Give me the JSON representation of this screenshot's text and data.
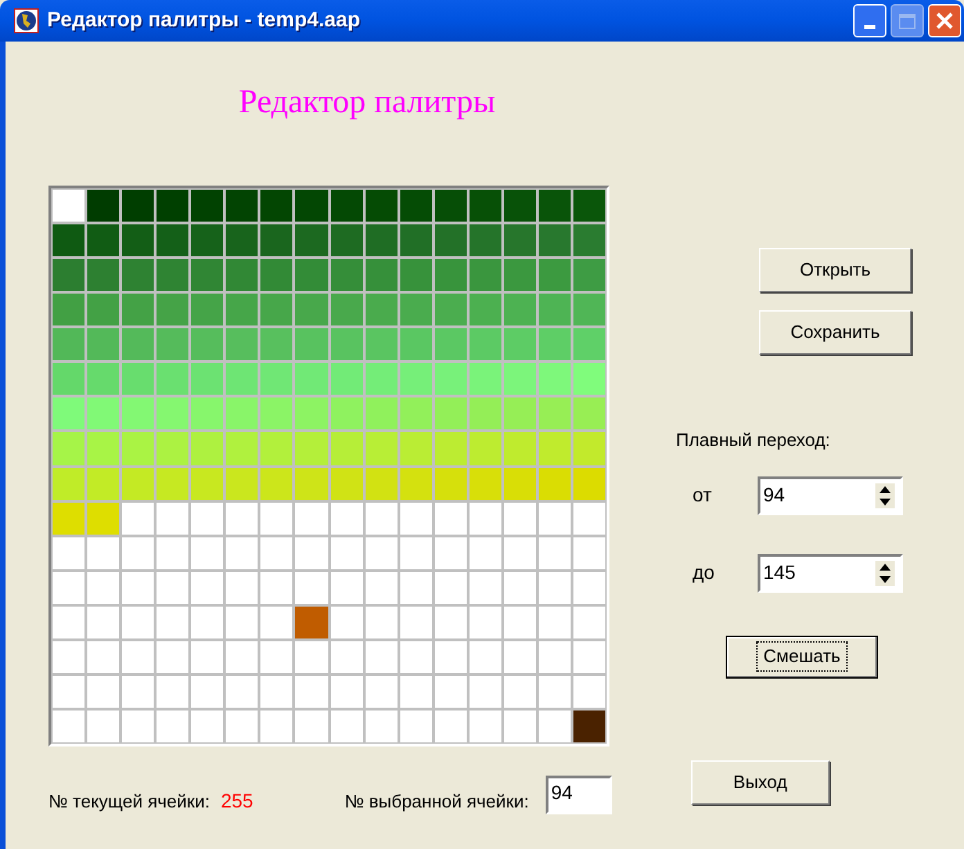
{
  "window": {
    "title": "Редактор палитры - temp4.aap",
    "maximize_disabled": true
  },
  "heading": "Редактор палитры",
  "palette": {
    "cells": [
      {
        "color": "#ffffff"
      },
      {
        "color": "#003c00"
      },
      {
        "color": "#003e00"
      },
      {
        "color": "#004000"
      },
      {
        "color": "#014201"
      },
      {
        "color": "#024402"
      },
      {
        "color": "#034602"
      },
      {
        "color": "#034703"
      },
      {
        "color": "#044904"
      },
      {
        "color": "#054b04"
      },
      {
        "color": "#054c05"
      },
      {
        "color": "#064e06"
      },
      {
        "color": "#075006"
      },
      {
        "color": "#085208"
      },
      {
        "color": "#095409"
      },
      {
        "color": "#0a560a"
      },
      {
        "color": "#0f5a12"
      },
      {
        "color": "#115c14"
      },
      {
        "color": "#135e16"
      },
      {
        "color": "#146018"
      },
      {
        "color": "#16621a"
      },
      {
        "color": "#18641c"
      },
      {
        "color": "#1a661e"
      },
      {
        "color": "#1c6920"
      },
      {
        "color": "#1e6b22"
      },
      {
        "color": "#1f6d24"
      },
      {
        "color": "#216f26"
      },
      {
        "color": "#237128"
      },
      {
        "color": "#25742a"
      },
      {
        "color": "#27762c"
      },
      {
        "color": "#28782e"
      },
      {
        "color": "#2a7c30"
      },
      {
        "color": "#2c7e30"
      },
      {
        "color": "#2d8031"
      },
      {
        "color": "#2e8232"
      },
      {
        "color": "#2f8433"
      },
      {
        "color": "#308634"
      },
      {
        "color": "#318835"
      },
      {
        "color": "#328a36"
      },
      {
        "color": "#338c37"
      },
      {
        "color": "#358e39"
      },
      {
        "color": "#36903a"
      },
      {
        "color": "#37923b"
      },
      {
        "color": "#38943c"
      },
      {
        "color": "#3a963e"
      },
      {
        "color": "#3b983f"
      },
      {
        "color": "#3c9a40"
      },
      {
        "color": "#3e9c44"
      },
      {
        "color": "#42a044"
      },
      {
        "color": "#43a145"
      },
      {
        "color": "#44a246"
      },
      {
        "color": "#45a347"
      },
      {
        "color": "#45a448"
      },
      {
        "color": "#46a649"
      },
      {
        "color": "#47a74a"
      },
      {
        "color": "#48a84b"
      },
      {
        "color": "#49a94c"
      },
      {
        "color": "#4aab4d"
      },
      {
        "color": "#4aac4e"
      },
      {
        "color": "#4bad4f"
      },
      {
        "color": "#4cb050"
      },
      {
        "color": "#4db252"
      },
      {
        "color": "#4eb454"
      },
      {
        "color": "#50b656"
      },
      {
        "color": "#52b858"
      },
      {
        "color": "#53b959"
      },
      {
        "color": "#54ba5a"
      },
      {
        "color": "#55bb5b"
      },
      {
        "color": "#56bd5c"
      },
      {
        "color": "#57be5d"
      },
      {
        "color": "#58c05e"
      },
      {
        "color": "#58c25f"
      },
      {
        "color": "#59c360"
      },
      {
        "color": "#5ac561"
      },
      {
        "color": "#5ac762"
      },
      {
        "color": "#5bc863"
      },
      {
        "color": "#5cca64"
      },
      {
        "color": "#5dcc65"
      },
      {
        "color": "#5ece66"
      },
      {
        "color": "#5fd068"
      },
      {
        "color": "#64d86a"
      },
      {
        "color": "#66da6c"
      },
      {
        "color": "#68dd6e"
      },
      {
        "color": "#6ae070"
      },
      {
        "color": "#6ce272"
      },
      {
        "color": "#6ee574"
      },
      {
        "color": "#70e775"
      },
      {
        "color": "#71e976"
      },
      {
        "color": "#72eb77"
      },
      {
        "color": "#74ed78"
      },
      {
        "color": "#76ef79"
      },
      {
        "color": "#78f17a"
      },
      {
        "color": "#7af37a"
      },
      {
        "color": "#7cf57b"
      },
      {
        "color": "#7ef87b"
      },
      {
        "color": "#80fc7c"
      },
      {
        "color": "#7ffa7a"
      },
      {
        "color": "#81f976"
      },
      {
        "color": "#83f873"
      },
      {
        "color": "#85f770"
      },
      {
        "color": "#87f66c"
      },
      {
        "color": "#89f569"
      },
      {
        "color": "#8bf466"
      },
      {
        "color": "#8df363"
      },
      {
        "color": "#8ff25f"
      },
      {
        "color": "#90f15c"
      },
      {
        "color": "#92f05a"
      },
      {
        "color": "#93ef58"
      },
      {
        "color": "#94ee57"
      },
      {
        "color": "#96ee56"
      },
      {
        "color": "#97ee55"
      },
      {
        "color": "#98ee54"
      },
      {
        "color": "#a6f448"
      },
      {
        "color": "#a8f446"
      },
      {
        "color": "#aaf344"
      },
      {
        "color": "#acf242"
      },
      {
        "color": "#aef140"
      },
      {
        "color": "#b0f13e"
      },
      {
        "color": "#b2f03c"
      },
      {
        "color": "#b4ef3a"
      },
      {
        "color": "#b6ee38"
      },
      {
        "color": "#b8ee36"
      },
      {
        "color": "#baed34"
      },
      {
        "color": "#bcec32"
      },
      {
        "color": "#bdec30"
      },
      {
        "color": "#bfeb2e"
      },
      {
        "color": "#c0eb2d"
      },
      {
        "color": "#c2ea2c"
      },
      {
        "color": "#c0ec28"
      },
      {
        "color": "#c2eb26"
      },
      {
        "color": "#c4ea24"
      },
      {
        "color": "#c6e922"
      },
      {
        "color": "#c8e820"
      },
      {
        "color": "#cae71e"
      },
      {
        "color": "#cce61b"
      },
      {
        "color": "#cee418"
      },
      {
        "color": "#d0e315"
      },
      {
        "color": "#d2e212"
      },
      {
        "color": "#d4e10f"
      },
      {
        "color": "#d6e00c"
      },
      {
        "color": "#d8df09"
      },
      {
        "color": "#d9de06"
      },
      {
        "color": "#dadd03"
      },
      {
        "color": "#dcdc00"
      },
      {
        "color": "#dede00"
      },
      {
        "color": "#dede00"
      },
      {
        "color": "#ffffff"
      },
      {
        "color": "#ffffff"
      },
      {
        "color": "#ffffff"
      },
      {
        "color": "#ffffff"
      },
      {
        "color": "#ffffff"
      },
      {
        "color": "#ffffff"
      },
      {
        "color": "#ffffff"
      },
      {
        "color": "#ffffff"
      },
      {
        "color": "#ffffff"
      },
      {
        "color": "#ffffff"
      },
      {
        "color": "#ffffff"
      },
      {
        "color": "#ffffff"
      },
      {
        "color": "#ffffff"
      },
      {
        "color": "#ffffff"
      },
      {
        "color": "#ffffff"
      },
      {
        "color": "#ffffff"
      },
      {
        "color": "#ffffff"
      },
      {
        "color": "#ffffff"
      },
      {
        "color": "#ffffff"
      },
      {
        "color": "#ffffff"
      },
      {
        "color": "#ffffff"
      },
      {
        "color": "#ffffff"
      },
      {
        "color": "#ffffff"
      },
      {
        "color": "#ffffff"
      },
      {
        "color": "#ffffff"
      },
      {
        "color": "#ffffff"
      },
      {
        "color": "#ffffff"
      },
      {
        "color": "#ffffff"
      },
      {
        "color": "#ffffff"
      },
      {
        "color": "#ffffff"
      },
      {
        "color": "#ffffff"
      },
      {
        "color": "#ffffff"
      },
      {
        "color": "#ffffff"
      },
      {
        "color": "#ffffff"
      },
      {
        "color": "#ffffff"
      },
      {
        "color": "#ffffff"
      },
      {
        "color": "#ffffff"
      },
      {
        "color": "#ffffff"
      },
      {
        "color": "#ffffff"
      },
      {
        "color": "#ffffff"
      },
      {
        "color": "#ffffff"
      },
      {
        "color": "#ffffff"
      },
      {
        "color": "#ffffff"
      },
      {
        "color": "#ffffff"
      },
      {
        "color": "#ffffff"
      },
      {
        "color": "#ffffff"
      },
      {
        "color": "#ffffff"
      },
      {
        "color": "#ffffff"
      },
      {
        "color": "#ffffff"
      },
      {
        "color": "#ffffff"
      },
      {
        "color": "#ffffff"
      },
      {
        "color": "#ffffff"
      },
      {
        "color": "#ffffff"
      },
      {
        "color": "#c05c00"
      },
      {
        "color": "#ffffff"
      },
      {
        "color": "#ffffff"
      },
      {
        "color": "#ffffff"
      },
      {
        "color": "#ffffff"
      },
      {
        "color": "#ffffff"
      },
      {
        "color": "#ffffff"
      },
      {
        "color": "#ffffff"
      },
      {
        "color": "#ffffff"
      },
      {
        "color": "#ffffff"
      },
      {
        "color": "#ffffff"
      },
      {
        "color": "#ffffff"
      },
      {
        "color": "#ffffff"
      },
      {
        "color": "#ffffff"
      },
      {
        "color": "#ffffff"
      },
      {
        "color": "#ffffff"
      },
      {
        "color": "#ffffff"
      },
      {
        "color": "#ffffff"
      },
      {
        "color": "#ffffff"
      },
      {
        "color": "#ffffff"
      },
      {
        "color": "#ffffff"
      },
      {
        "color": "#ffffff"
      },
      {
        "color": "#ffffff"
      },
      {
        "color": "#ffffff"
      },
      {
        "color": "#ffffff"
      },
      {
        "color": "#ffffff"
      },
      {
        "color": "#ffffff"
      },
      {
        "color": "#ffffff"
      },
      {
        "color": "#ffffff"
      },
      {
        "color": "#ffffff"
      },
      {
        "color": "#ffffff"
      },
      {
        "color": "#ffffff"
      },
      {
        "color": "#ffffff"
      },
      {
        "color": "#ffffff"
      },
      {
        "color": "#ffffff"
      },
      {
        "color": "#ffffff"
      },
      {
        "color": "#ffffff"
      },
      {
        "color": "#ffffff"
      },
      {
        "color": "#ffffff"
      },
      {
        "color": "#ffffff"
      },
      {
        "color": "#ffffff"
      },
      {
        "color": "#ffffff"
      },
      {
        "color": "#ffffff"
      },
      {
        "color": "#ffffff"
      },
      {
        "color": "#ffffff"
      },
      {
        "color": "#ffffff"
      },
      {
        "color": "#ffffff"
      },
      {
        "color": "#ffffff"
      },
      {
        "color": "#ffffff"
      },
      {
        "color": "#ffffff"
      },
      {
        "color": "#ffffff"
      },
      {
        "color": "#ffffff"
      },
      {
        "color": "#ffffff"
      },
      {
        "color": "#ffffff"
      },
      {
        "color": "#ffffff"
      },
      {
        "color": "#ffffff"
      },
      {
        "color": "#4a2200"
      }
    ]
  },
  "buttons": [
    {
      "label": "Открыть",
      "default": false
    },
    {
      "label": "Сохранить",
      "default": false
    }
  ],
  "blend": {
    "label": "Плавный переход:",
    "from_label": "от",
    "from_value": "94",
    "to_label": "до",
    "to_value": "145",
    "button": {
      "label": "Смешать",
      "default": true
    }
  },
  "footer": {
    "current_label": "№ текущей ячейки:",
    "current_value": "255",
    "selected_label": "№ выбранной ячейки:",
    "selected_value": "94",
    "exit_button": {
      "label": "Выход",
      "default": false
    }
  }
}
